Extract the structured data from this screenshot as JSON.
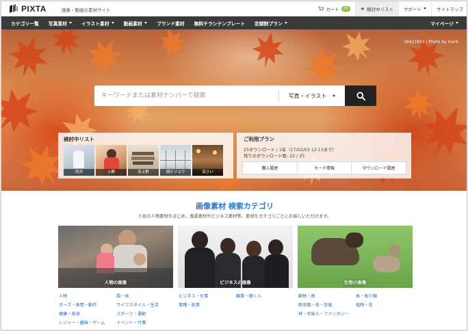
{
  "brand": {
    "name": "PIXTA",
    "tagline": "画像・動画の素材サイト"
  },
  "topnav": [
    {
      "label": "カート",
      "badge": "25",
      "icon": "cart-icon"
    },
    {
      "label": "検討中リスト",
      "icon": "star-icon"
    },
    {
      "label": "サポート",
      "icon": "caret-down-icon"
    },
    {
      "label": "サイトマップ"
    }
  ],
  "mainnav": [
    {
      "label": "カテゴリ一覧"
    },
    {
      "label": "写真素材"
    },
    {
      "label": "イラスト素材"
    },
    {
      "label": "動画素材"
    },
    {
      "label": "ブランド素材"
    },
    {
      "label": "無料チラシテンプレート"
    },
    {
      "label": "定額制プラン"
    }
  ],
  "mypage": "マイページ",
  "hero": {
    "credit": "18421603 | Photo by mark.",
    "search": {
      "placeholder": "キーワードまたは素材ナンバーで検索",
      "type": "写真・イラスト",
      "search_icon": "search-icon"
    }
  },
  "review": {
    "title": "検討中リスト",
    "items": [
      {
        "label": "同弁"
      },
      {
        "label": "上野"
      },
      {
        "label": "旧上野"
      },
      {
        "label": "胡汁リョウ"
      },
      {
        "label": "淳さい"
      }
    ]
  },
  "plan": {
    "title": "ご利用プラン",
    "line1": "25ダウンロード / 1年（17/02/03 12:13まで）",
    "line2": "残りのダウンロード数: 22 / 25",
    "buttons": [
      "購入履歴",
      "カード情報",
      "ダウンロード履歴"
    ]
  },
  "categories": {
    "title": "画像素材 検索カテゴリ",
    "subtitle": "人気の人物素材をはじめ、風景素材やビジネス素材等、素材をカテゴリごとにお探しいただけます。",
    "cards": [
      {
        "label": "人物の画像",
        "links_left": [
          "人物",
          "ポーズ・表情・動作",
          "健康・美容",
          "レジャー・趣味・ゲーム"
        ],
        "links_right": [
          "顔・体",
          "ライフスタイル・生活",
          "スポーツ・運動",
          "イベント・行事"
        ]
      },
      {
        "label": "ビジネスの画像",
        "links_left": [
          "ビジネス・仕事",
          "業種・産業"
        ],
        "links_right": [
          "職業・働く人"
        ]
      },
      {
        "label": "生物の画像",
        "links_left": [
          "動物・鳥",
          "爬虫類・虫・恐竜",
          "神・宇宙人・ファンタジー"
        ],
        "links_right": [
          "魚・魚介類",
          "植物・花"
        ]
      }
    ]
  }
}
